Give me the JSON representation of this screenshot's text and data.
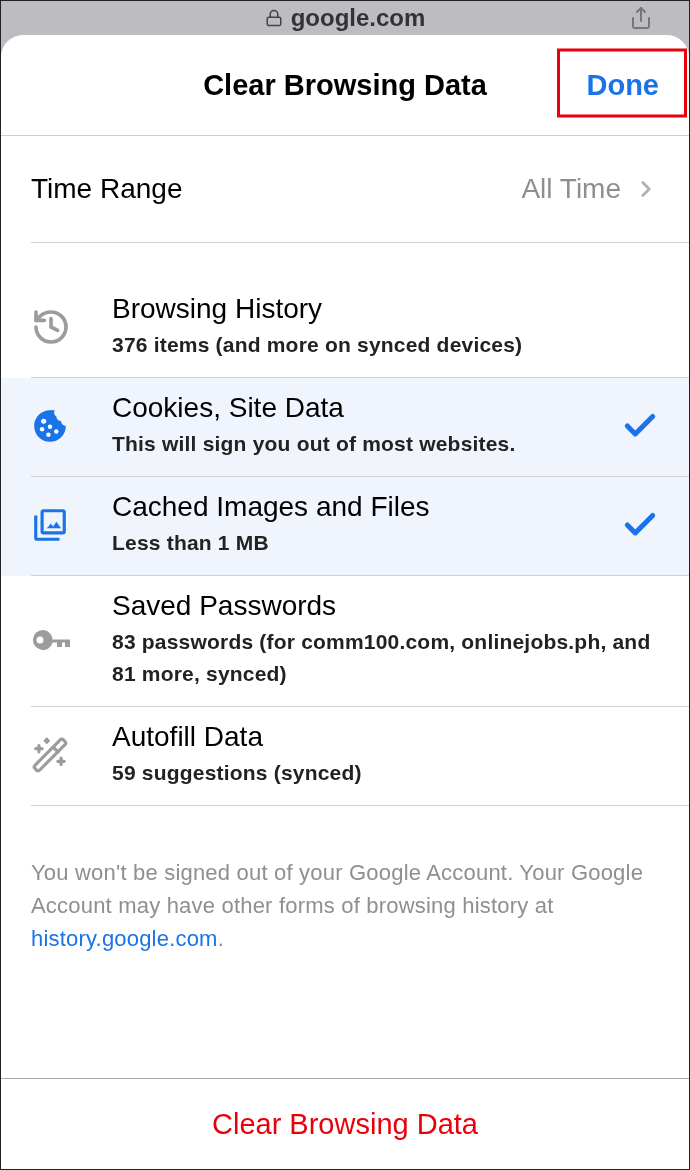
{
  "background": {
    "address": "google.com"
  },
  "header": {
    "title": "Clear Browsing Data",
    "done": "Done",
    "done_highlighted": true
  },
  "time_range": {
    "label": "Time Range",
    "value": "All Time"
  },
  "items": [
    {
      "title": "Browsing History",
      "subtitle": "376 items (and more on synced devices)",
      "selected": false
    },
    {
      "title": "Cookies, Site Data",
      "subtitle": "This will sign you out of most websites.",
      "selected": true
    },
    {
      "title": "Cached Images and Files",
      "subtitle": "Less than 1 MB",
      "selected": true
    },
    {
      "title": "Saved Passwords",
      "subtitle": "83 passwords (for comm100.com, onlinejobs.ph, and 81 more, synced)",
      "selected": false
    },
    {
      "title": "Autofill Data",
      "subtitle": "59 suggestions (synced)",
      "selected": false
    }
  ],
  "note": {
    "text_before": "You won't be signed out of your Google Account. Your Google Account may have other forms of browsing history at ",
    "link": "history.google.com",
    "text_after": "."
  },
  "action": {
    "label": "Clear Browsing Data"
  }
}
